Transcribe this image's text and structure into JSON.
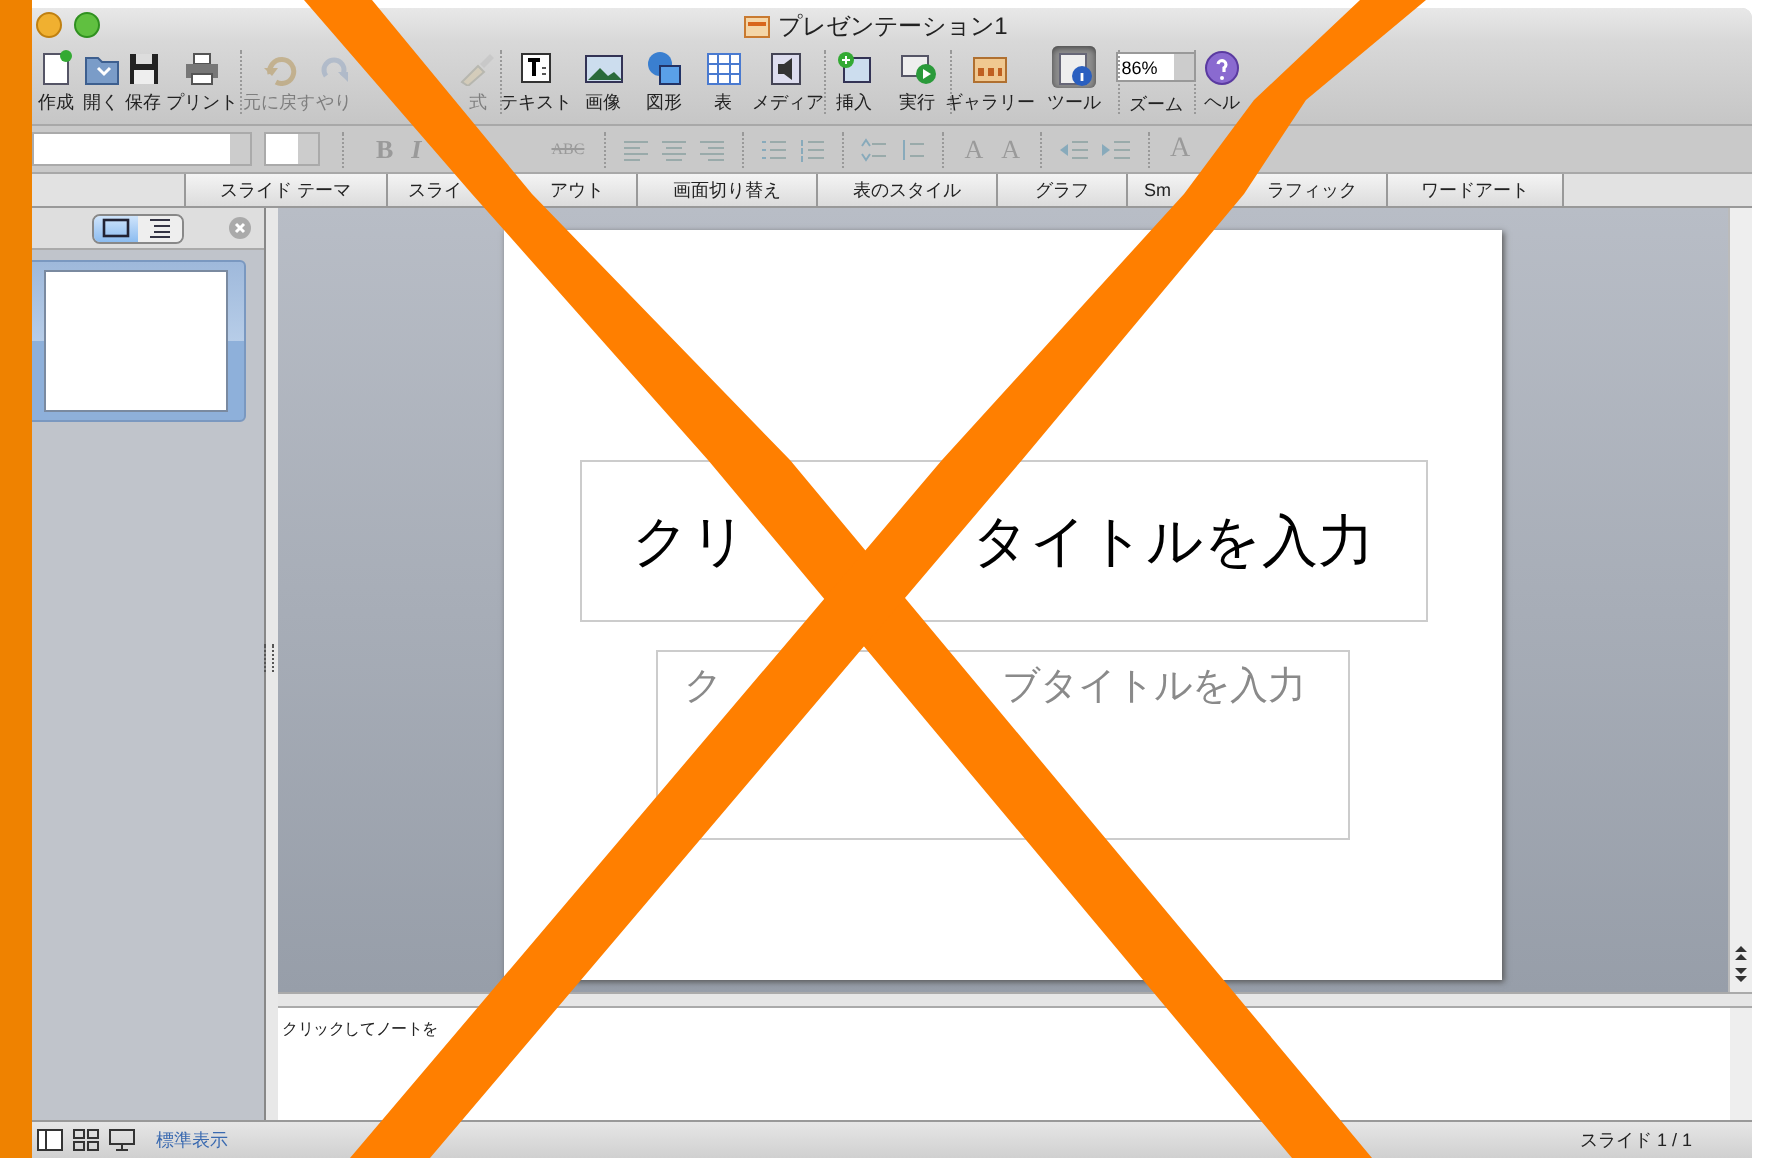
{
  "window": {
    "title": "プレゼンテーション1"
  },
  "toolbar": [
    {
      "kind": "button",
      "label": "作成",
      "disabled": false,
      "selected": false,
      "separator_before": false
    },
    {
      "kind": "button",
      "label": "開く",
      "disabled": false,
      "selected": false,
      "separator_before": false
    },
    {
      "kind": "button",
      "label": "保存",
      "disabled": false,
      "selected": false,
      "separator_before": false
    },
    {
      "kind": "button",
      "label": "プリント",
      "disabled": false,
      "selected": false,
      "separator_before": false
    },
    {
      "kind": "button",
      "label": "元に戻す",
      "disabled": true,
      "selected": false,
      "separator_before": true
    },
    {
      "kind": "button",
      "label": "やり",
      "disabled": true,
      "selected": false,
      "separator_before": false
    },
    {
      "kind": "button",
      "label": "式",
      "disabled": true,
      "selected": false,
      "separator_before": false
    },
    {
      "kind": "button",
      "label": "テキスト",
      "disabled": false,
      "selected": false,
      "separator_before": true
    },
    {
      "kind": "button",
      "label": "画像",
      "disabled": false,
      "selected": false,
      "separator_before": false
    },
    {
      "kind": "button",
      "label": "図形",
      "disabled": false,
      "selected": false,
      "separator_before": false
    },
    {
      "kind": "button",
      "label": "表",
      "disabled": false,
      "selected": false,
      "separator_before": false
    },
    {
      "kind": "button",
      "label": "メディア",
      "disabled": false,
      "selected": false,
      "separator_before": false
    },
    {
      "kind": "button",
      "label": "挿入",
      "disabled": false,
      "selected": false,
      "separator_before": true
    },
    {
      "kind": "button",
      "label": "実行",
      "disabled": false,
      "selected": false,
      "separator_before": false
    },
    {
      "kind": "button",
      "label": "ギャラリー",
      "disabled": false,
      "selected": false,
      "separator_before": true
    },
    {
      "kind": "button",
      "label": "ツール",
      "disabled": false,
      "selected": true,
      "separator_before": false
    },
    {
      "kind": "zoom",
      "label": "ズーム",
      "value": "86%",
      "separator_before": true
    },
    {
      "kind": "button",
      "label": "ヘル",
      "disabled": false,
      "selected": false,
      "separator_before": true
    }
  ],
  "format_bar": {
    "text_buttons": [
      "B",
      "I",
      "ABC"
    ],
    "size_buttons": [
      "A",
      "A"
    ],
    "color_button": "A"
  },
  "ribbon_tabs": [
    {
      "parts": [
        "スライド テーマ"
      ],
      "selected": false
    },
    {
      "parts": [
        "スライ",
        "アウト"
      ],
      "selected": false
    },
    {
      "parts": [
        "画面切り替え"
      ],
      "selected": false
    },
    {
      "parts": [
        "表のスタイル"
      ],
      "selected": false
    },
    {
      "parts": [
        "グラフ"
      ],
      "selected": false
    },
    {
      "parts": [
        "Sm",
        "ラフィック"
      ],
      "selected": false
    },
    {
      "parts": [
        "ワードアート"
      ],
      "selected": false
    }
  ],
  "slides_pane": {
    "views": [
      {
        "kind": "slides",
        "selected": true
      },
      {
        "kind": "outline",
        "selected": false
      }
    ],
    "thumbnails": [
      {
        "selected": true
      }
    ]
  },
  "slide": {
    "title_parts": [
      "クリ",
      "タイトルを入力"
    ],
    "subtitle_parts": [
      "ク",
      "ブタイトルを入力"
    ]
  },
  "notes": {
    "placeholder": "クリックしてノートを"
  },
  "status_bar": {
    "view_label": "標準表示",
    "slide_counter": "スライド 1 / 1"
  }
}
